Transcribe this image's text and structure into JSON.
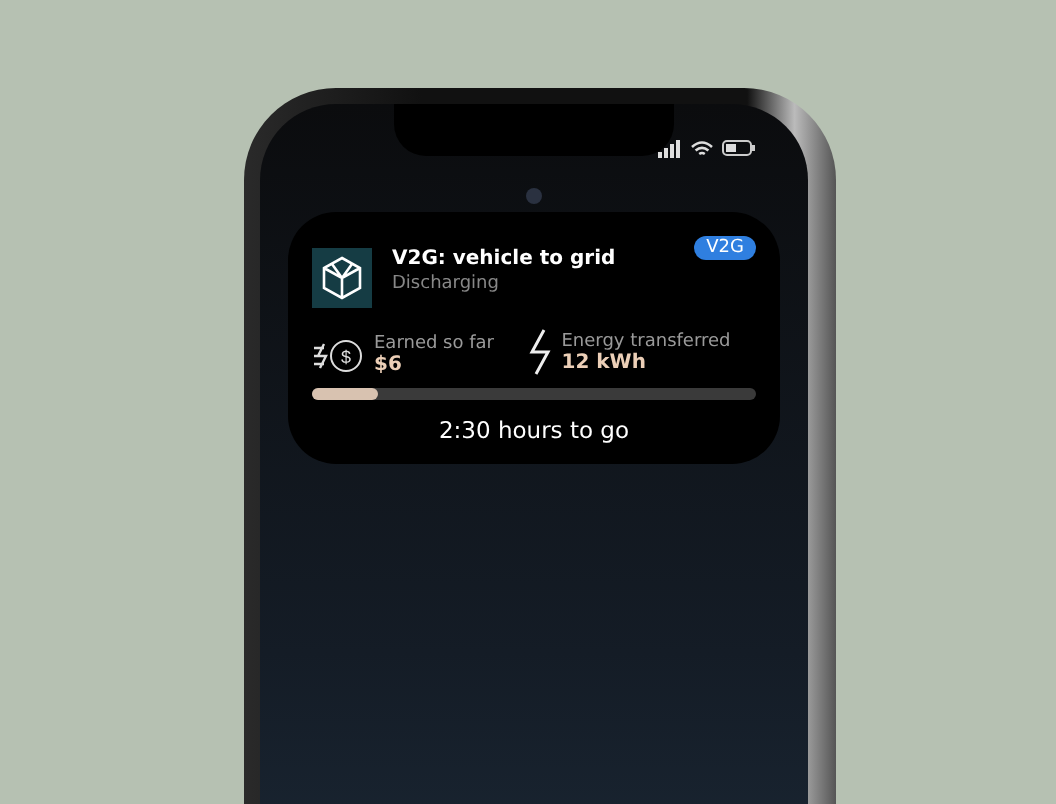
{
  "notification": {
    "title": "V2G: vehicle to grid",
    "subtitle": "Discharging",
    "badge": "V2G",
    "stats": [
      {
        "kind": "money",
        "label": "Earned so far",
        "value": "$6",
        "symbol": "$"
      },
      {
        "kind": "energy",
        "label": "Energy transferred",
        "value": "12 kWh"
      }
    ],
    "progress": {
      "level": 0.15
    },
    "remaining": "2:30 hours to go"
  }
}
